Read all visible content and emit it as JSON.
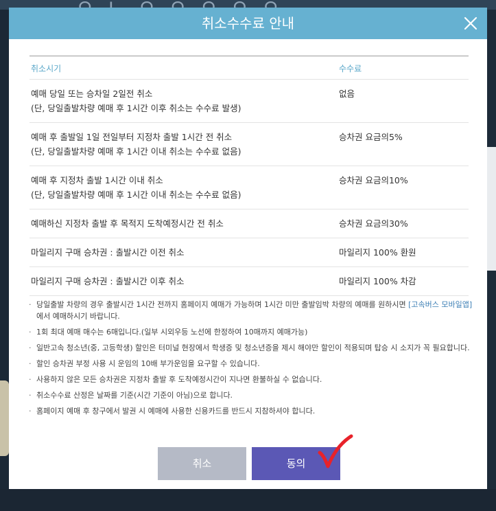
{
  "modal": {
    "title": "취소수수료 안내",
    "close_icon": "close-icon"
  },
  "table": {
    "headers": {
      "time": "취소시기",
      "fee": "수수료"
    },
    "rows": [
      {
        "line1": "예매 당일 또는 승차일 2일전 취소",
        "line2": "(단, 당일출발차량 예매 후 1시간 이후 취소는 수수료 발생)",
        "fee": "없음"
      },
      {
        "line1": "예매 후 출발일 1일 전일부터 지정차 출발 1시간 전 취소",
        "line2": "(단, 당일출발차량 예매 후 1시간 이내 취소는 수수료 없음)",
        "fee": "승차권 요금의5%"
      },
      {
        "line1": "예매 후 지정차 출발 1시간 이내 취소",
        "line2": "(단, 당일출발차량 예매 후 1시간 이내 취소는 수수료 없음)",
        "fee": "승차권 요금의10%"
      },
      {
        "line1": "예매하신 지정차 출발 후 목적지 도착예정시간 전 취소",
        "line2": "",
        "fee": "승차권 요금의30%"
      },
      {
        "line1": "마일리지 구매 승차권 : 출발시간 이전 취소",
        "line2": "",
        "fee": "마일리지 100% 환원"
      },
      {
        "line1": "마일리지 구매 승차권 : 출발시간 이후 취소",
        "line2": "",
        "fee": "마일리지 100% 차감"
      }
    ]
  },
  "notes": {
    "n1a": "당일출발 차량의 경우 출발시간 1시간 전까지 홈페이지 예매가 가능하며 1시간 미만 출발임박 차량의 예매를 원하시면",
    "n1_link": "[고속버스 모바일앱]",
    "n1b": "에서 예매하시기 바랍니다.",
    "n2": "1회 최대 예매 매수는 6매입니다.(일부 시외우등 노선에 한정하여 10매까지 예매가능)",
    "n3": "일반고속 청소년(중, 고등학생) 할인은 터미널 현장에서 학생증 및 청소년증을 제시 해야만 할인이 적용되며 탑승 시 소지가 꼭 필요합니다.",
    "n4": "할인 승차권 부정 사용 시 운임의 10배 부가운임을 요구할 수 있습니다.",
    "n5": "사용하지 않은 모든 승차권은 지정차 출발 후 도착예정시간이 지나면 환불하실 수 없습니다.",
    "n6": "취소수수료 산정은 날짜를 기준(시간 기준이 아님)으로 합니다.",
    "n7": "홈페이지 예매 후 창구에서 발권 시 예매에 사용한 신용카드를 반드시 지참하셔야 합니다."
  },
  "buttons": {
    "cancel": "취소",
    "agree": "동의"
  },
  "colors": {
    "header": "#66b1d1",
    "accent_text": "#5aa7c9",
    "agree": "#5b58b5",
    "cancel": "#b5bac6",
    "checkmark": "#e8222a"
  }
}
